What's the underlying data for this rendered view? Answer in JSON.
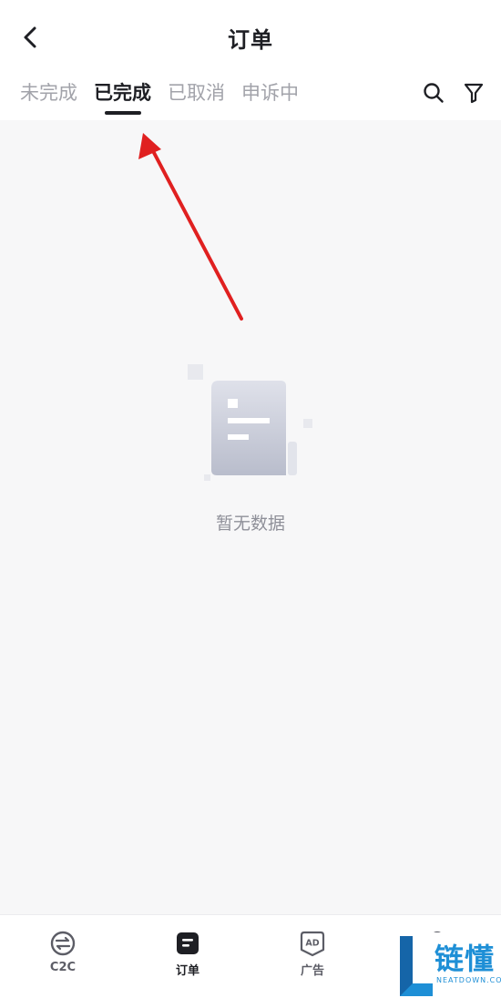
{
  "header": {
    "title": "订单",
    "tabs": [
      {
        "label": "未完成",
        "active": false
      },
      {
        "label": "已完成",
        "active": true
      },
      {
        "label": "已取消",
        "active": false
      },
      {
        "label": "申诉中",
        "active": false
      }
    ],
    "icons": [
      "back-arrow-icon",
      "search-icon",
      "filter-icon"
    ]
  },
  "empty_state": {
    "message": "暂无数据",
    "icon": "empty-document-icon"
  },
  "annotation": {
    "icon": "red-arrow",
    "color": "#e02020"
  },
  "bottom_nav": {
    "items": [
      {
        "label": "C2C",
        "icon": "c2c-icon",
        "active": false
      },
      {
        "label": "订单",
        "icon": "orders-icon",
        "active": true
      },
      {
        "label": "广告",
        "icon": "ad-icon",
        "active": false
      }
    ]
  },
  "watermark": {
    "logo_text": "链懂",
    "sub_text": "NEATDOWN.COM"
  },
  "colors": {
    "accent": "#1e1f24",
    "inactive_text": "#a2a3aa",
    "background": "#f7f7f8",
    "watermark_blue": "#1e8fd6"
  }
}
